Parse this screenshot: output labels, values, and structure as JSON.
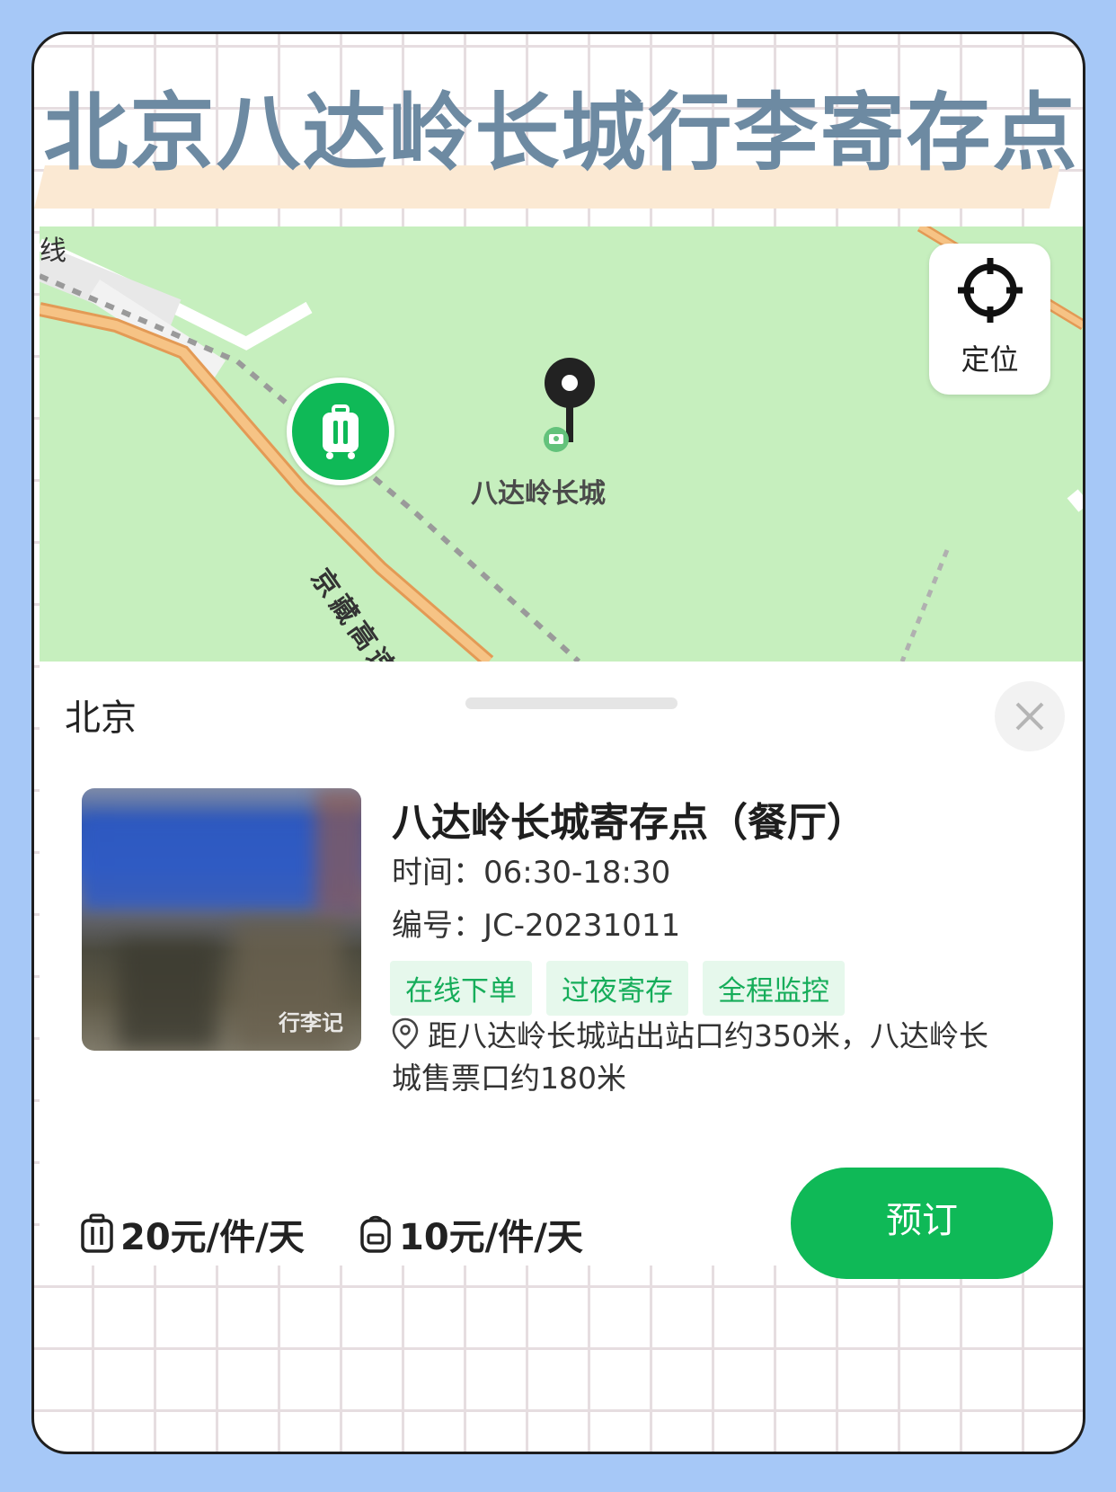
{
  "header": {
    "title": "北京八达岭长城行李寄存点"
  },
  "map": {
    "corner_char": "线",
    "locate_label": "定位",
    "poi_label": "八达岭长城",
    "road_label": "京藏高速"
  },
  "panel": {
    "city": "北京",
    "store": {
      "name": "八达岭长城寄存点（餐厅）",
      "hours": "时间：06:30-18:30",
      "code": "编号：JC-20231011",
      "tags": [
        "在线下单",
        "过夜寄存",
        "全程监控"
      ],
      "address": "距八达岭长城站出站口约350米，八达岭长城售票口约180米",
      "photo_watermark": "行李记"
    },
    "prices": {
      "large": "20元/件/天",
      "small": "10元/件/天"
    },
    "book_label": "预订"
  },
  "colors": {
    "background": "#a6c8f7",
    "accent_green": "#0fb957",
    "map_green": "#c6efbe",
    "title_color": "#6d8aa2",
    "title_highlight": "#fbe9d3"
  },
  "icons": [
    "locate-crosshair-icon",
    "luggage-icon",
    "map-pin-icon",
    "close-icon",
    "location-outline-icon",
    "suitcase-icon",
    "backpack-icon"
  ]
}
